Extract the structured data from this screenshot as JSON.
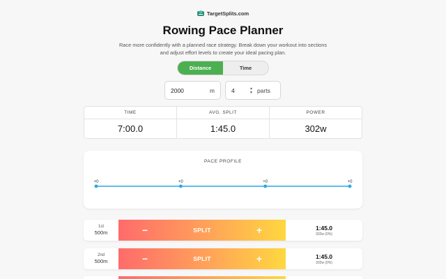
{
  "brand": {
    "name": "TargetSplits.com",
    "icon": "rower-logo-icon",
    "color": "#2f8f7a"
  },
  "page": {
    "title": "Rowing Pace Planner",
    "subtitle": "Race more confidently with a planned race strategy. Break down your workout into sections and adjust effort levels to create your ideal pacing plan."
  },
  "mode_toggle": {
    "options": [
      "Distance",
      "Time"
    ],
    "selected": "Distance",
    "active_color": "#4caf50"
  },
  "inputs": {
    "distance": {
      "value": "2000",
      "unit": "m"
    },
    "parts": {
      "value": "4",
      "unit": "parts",
      "stepper_up": "▲",
      "stepper_down": "▼"
    }
  },
  "summary": [
    {
      "label": "TIME",
      "value": "7:00.0"
    },
    {
      "label": "AVG. SPLIT",
      "value": "1:45.0"
    },
    {
      "label": "POWER",
      "value": "302w"
    }
  ],
  "pace_profile": {
    "title": "PACE PROFILE",
    "points": [
      "+0",
      "+0",
      "+0",
      "+0"
    ],
    "line_color": "#29a9e0"
  },
  "segments": [
    {
      "ordinal": "1st",
      "distance": "500m",
      "minus": "−",
      "label": "SPLIT",
      "plus": "+",
      "split": "1:45.0",
      "power": "302w (0%)"
    },
    {
      "ordinal": "2nd",
      "distance": "500m",
      "minus": "−",
      "label": "SPLIT",
      "plus": "+",
      "split": "1:45.0",
      "power": "302w (0%)"
    }
  ],
  "gradient": {
    "start": "#ff6b6b",
    "end": "#ffd740"
  }
}
